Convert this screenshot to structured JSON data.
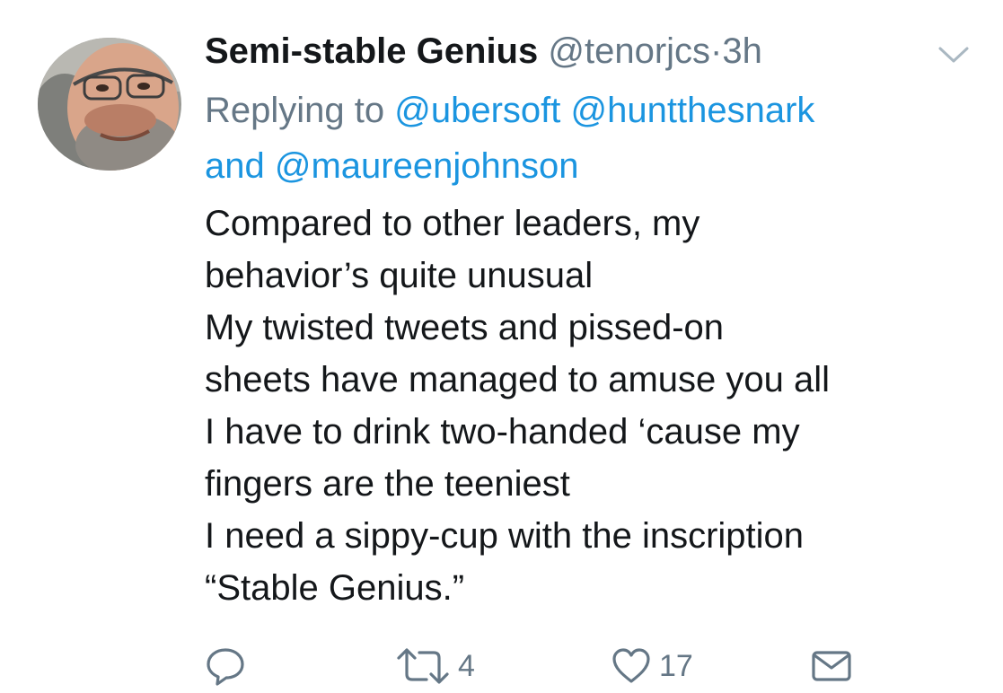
{
  "tweet": {
    "display_name": "Semi-stable Genius",
    "handle": "@tenorjcs",
    "separator": "·",
    "time": "3h",
    "replying_prefix": "Replying to",
    "mentions": [
      "@ubersoft",
      "@huntthesnark",
      "@maureenjohnson"
    ],
    "mention_join": "and",
    "text_lines": [
      "Compared to other leaders, my",
      "behavior’s quite unusual",
      "My twisted tweets and pissed-on",
      "sheets have managed to amuse you all",
      "I have to drink two-handed ‘cause my",
      "fingers are the teeniest",
      "I need a sippy-cup with the inscription",
      "“Stable Genius.”"
    ]
  },
  "actions": {
    "reply_icon": "reply-bubble-icon",
    "retweet_icon": "retweet-icon",
    "retweet_count": "4",
    "like_icon": "heart-icon",
    "like_count": "17",
    "dm_icon": "envelope-icon"
  },
  "colors": {
    "text": "#14171a",
    "secondary": "#657786",
    "link": "#1b95e0"
  }
}
